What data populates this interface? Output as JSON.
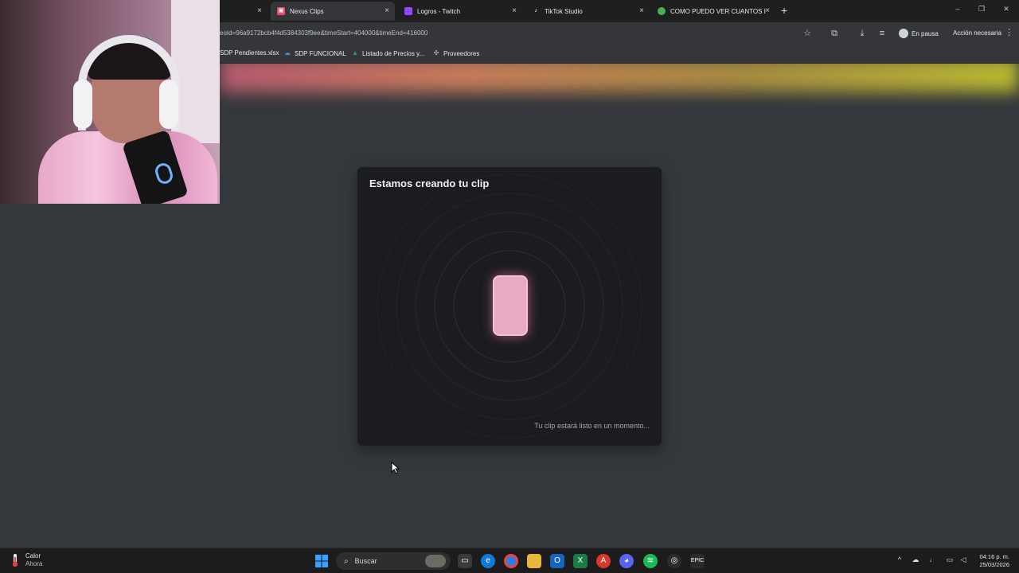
{
  "tabs": [
    {
      "label": "",
      "favicon": "",
      "close": "×"
    },
    {
      "label": "Nexus Clips",
      "favicon": "nexus-icon",
      "close": "×"
    },
    {
      "label": "Logros - Twitch",
      "favicon": "twitch-icon",
      "close": "×"
    },
    {
      "label": "TikTok Studio",
      "favicon": "tiktok-icon",
      "close": "×"
    },
    {
      "label": "COMO PUEDO VER CUANTOS I",
      "favicon": "chrome-icon",
      "close": "×"
    }
  ],
  "new_tab": "+",
  "window": {
    "minimize": "–",
    "restore": "❐",
    "close": "✕"
  },
  "address": {
    "url": "eoId=96a9172bcb4f4d5384303f9ee&timeStart=404000&timeEnd=416000"
  },
  "profile": {
    "label": "En pausa"
  },
  "action_required": "Acción necesaria",
  "bookmarks": [
    {
      "label": "SDP Pendientes.xlsx",
      "icon": "file-icon"
    },
    {
      "label": "SDP FUNCIONAL",
      "icon": "cloud-icon"
    },
    {
      "label": "Listado de Precios y...",
      "icon": "drive-icon"
    },
    {
      "label": "Proveedores",
      "icon": "puzzle-icon"
    }
  ],
  "card": {
    "title": "Estamos creando tu clip",
    "status": "Tu clip estará listo en un momento..."
  },
  "taskbar": {
    "weather_title": "Calor",
    "weather_sub": "Ahora",
    "search_label": "Buscar",
    "time": "04:16 p. m.",
    "date": "25/03/2026"
  },
  "colors": {
    "page_bg": "#34373c",
    "card_bg": "#1b1c1f",
    "phone_pink": "#e9a9c3",
    "chrome_dark": "#35363a"
  }
}
